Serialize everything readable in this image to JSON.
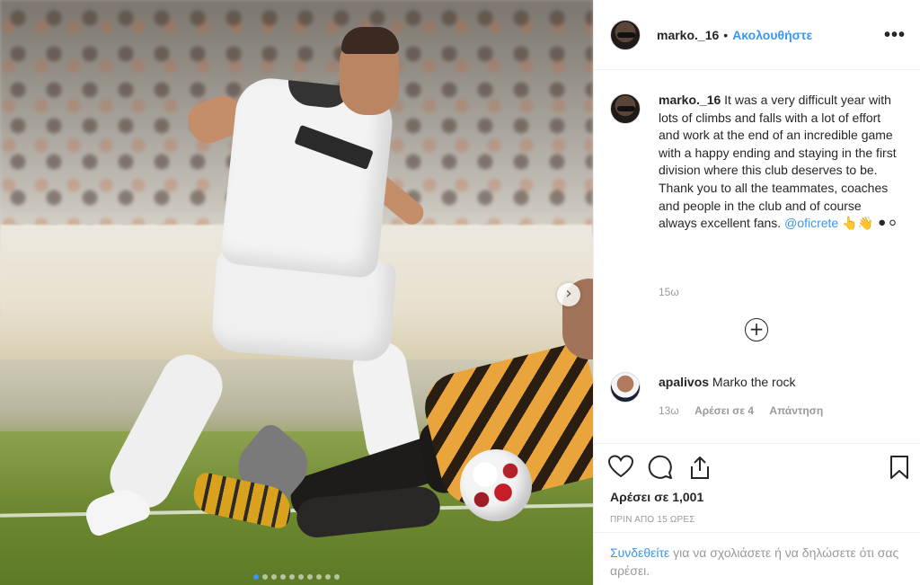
{
  "post": {
    "image_alt": "footballer in white kit avoiding a sliding tackle",
    "carousel": {
      "total": 10,
      "active": 0,
      "next_icon": "chevron-right-icon"
    }
  },
  "header": {
    "username": "marko._16",
    "separator": "•",
    "follow_label": "Ακολουθήστε",
    "more_icon": "ellipsis-icon",
    "more_label": "•••"
  },
  "caption": {
    "username": "marko._16",
    "text": " It was a very difficult year with lots of climbs and falls with a lot of effort and work at the end of an incredible game with a happy ending and staying in the first division where this club deserves to be. Thank you to all the teammates, coaches and people in the club and of course always excellent fans. ",
    "mention": "@oficrete",
    "emoji": " 👆👋 ⚫⚪",
    "time": "15ω"
  },
  "load_more": {
    "icon": "plus-circle-icon",
    "label": "+"
  },
  "comments": [
    {
      "username": "apalivos",
      "text": " Marko the rock",
      "time": "13ω",
      "likes_label": "Αρέσει σε 4",
      "reply_label": "Απάντηση"
    }
  ],
  "actions": {
    "like_icon": "heart-icon",
    "comment_icon": "comment-icon",
    "share_icon": "share-icon",
    "save_icon": "bookmark-icon"
  },
  "likes": "Αρέσει σε 1,001",
  "posted_ago": "ΠΡΙΝ ΑΠΟ 15 ΩΡΕΣ",
  "login_prompt": {
    "link": "Συνδεθείτε",
    "text": " για να σχολιάσετε ή να δηλώσετε ότι σας αρέσει."
  },
  "colors": {
    "accent": "#3897f0",
    "text": "#262626",
    "muted": "#999999",
    "border": "#efefef"
  }
}
